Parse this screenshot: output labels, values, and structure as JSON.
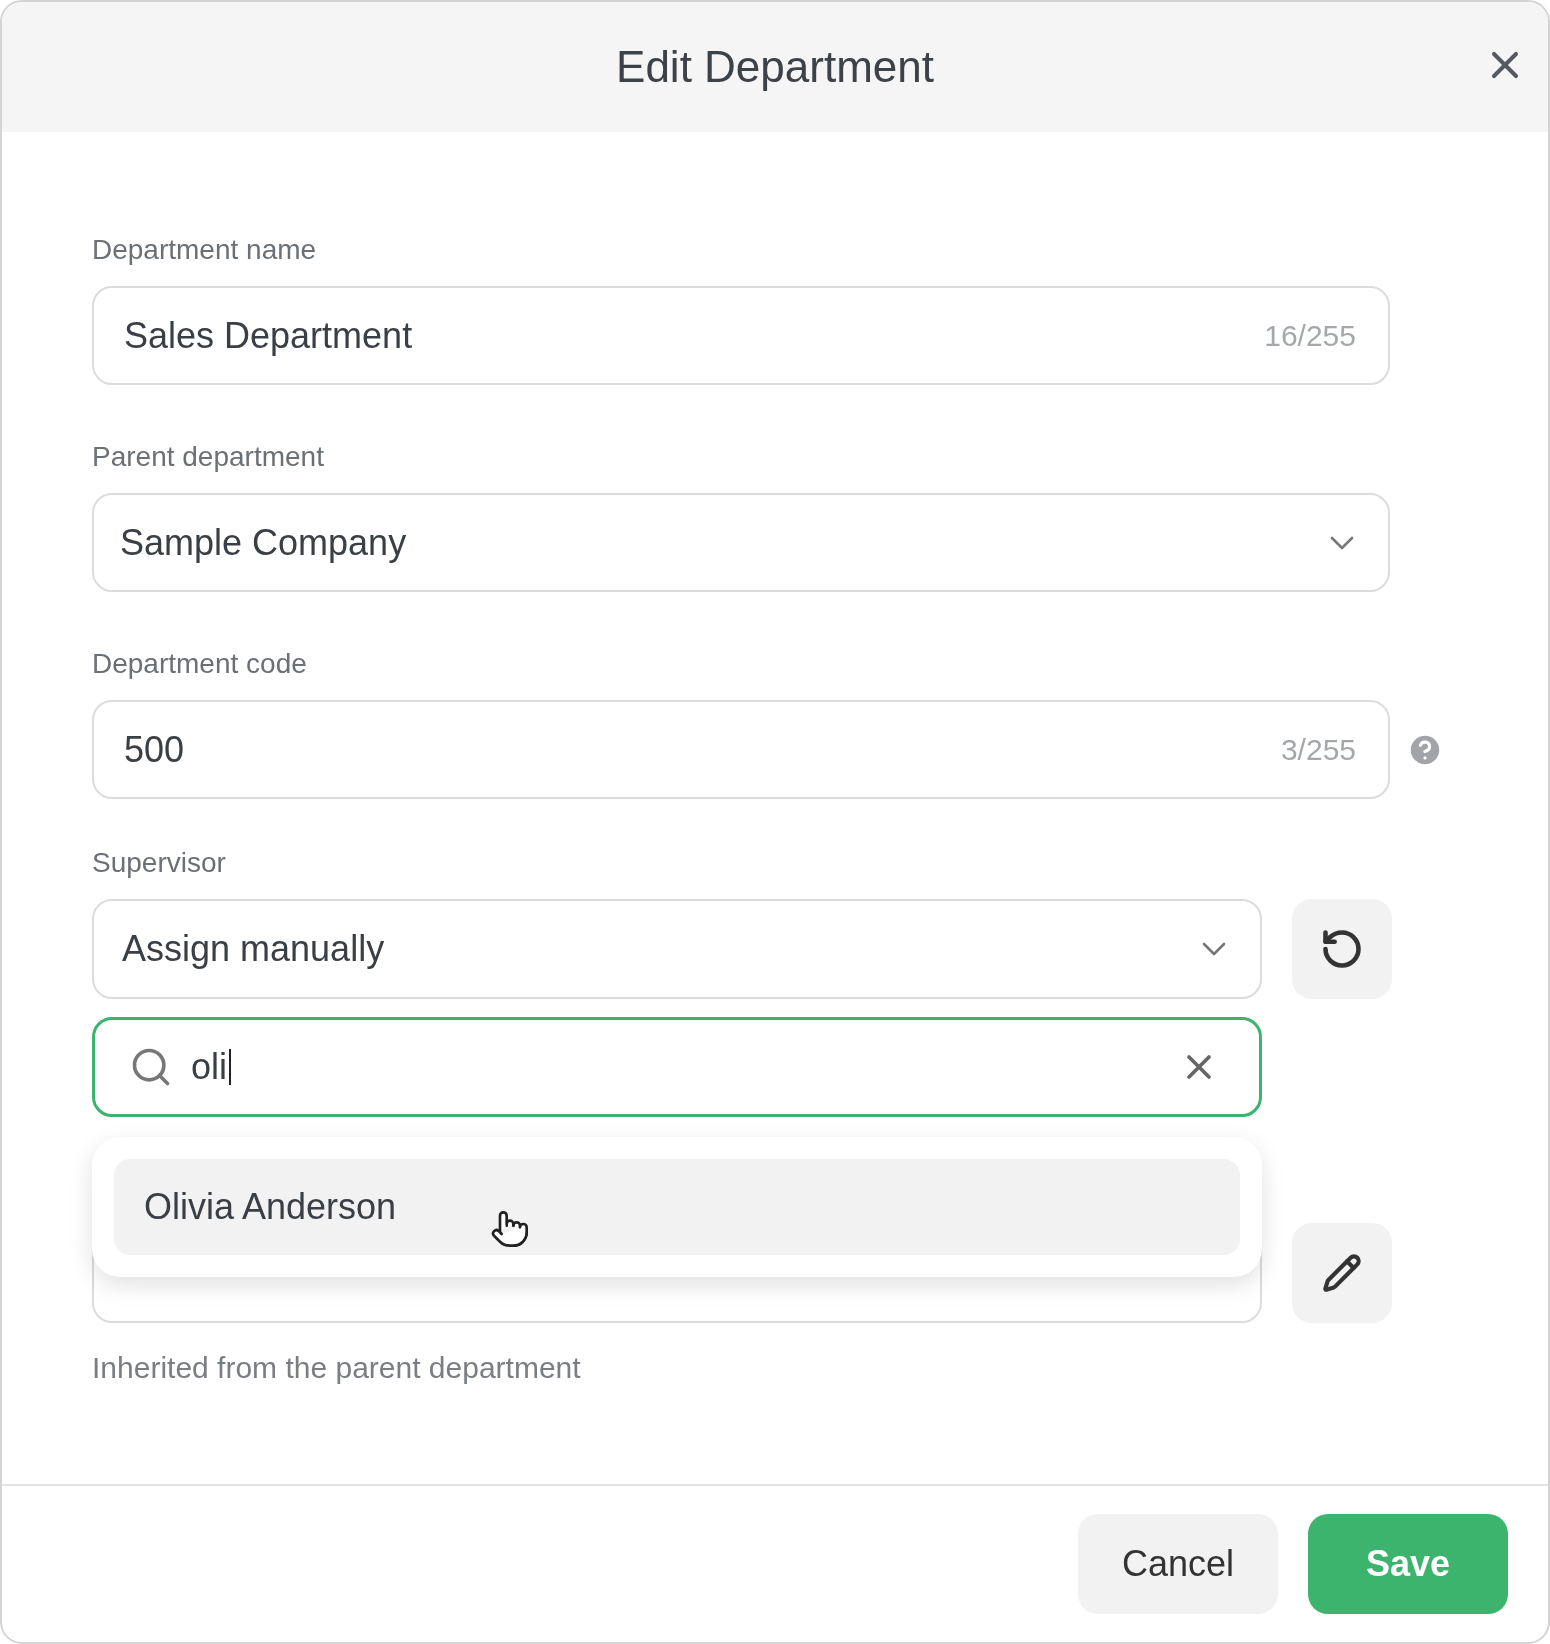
{
  "dialog": {
    "title": "Edit Department"
  },
  "fields": [
    {
      "kind": "text",
      "label": "Department name",
      "value": "Sales Department",
      "counter": "16/255",
      "help": false
    },
    {
      "kind": "select",
      "label": "Parent department",
      "value": "Sample Company"
    },
    {
      "kind": "text",
      "label": "Department code",
      "value": "500",
      "counter": "3/255",
      "help": true
    }
  ],
  "supervisor": {
    "label": "Supervisor",
    "mode": "Assign manually",
    "search": {
      "value": "oli",
      "focused": true
    },
    "results": [
      {
        "name": "Olivia Anderson",
        "selected": true
      }
    ],
    "hint": "Inherited from the parent department"
  },
  "buttons": [
    {
      "label": "Cancel",
      "kind": "secondary"
    },
    {
      "label": "Save",
      "kind": "primary"
    }
  ]
}
